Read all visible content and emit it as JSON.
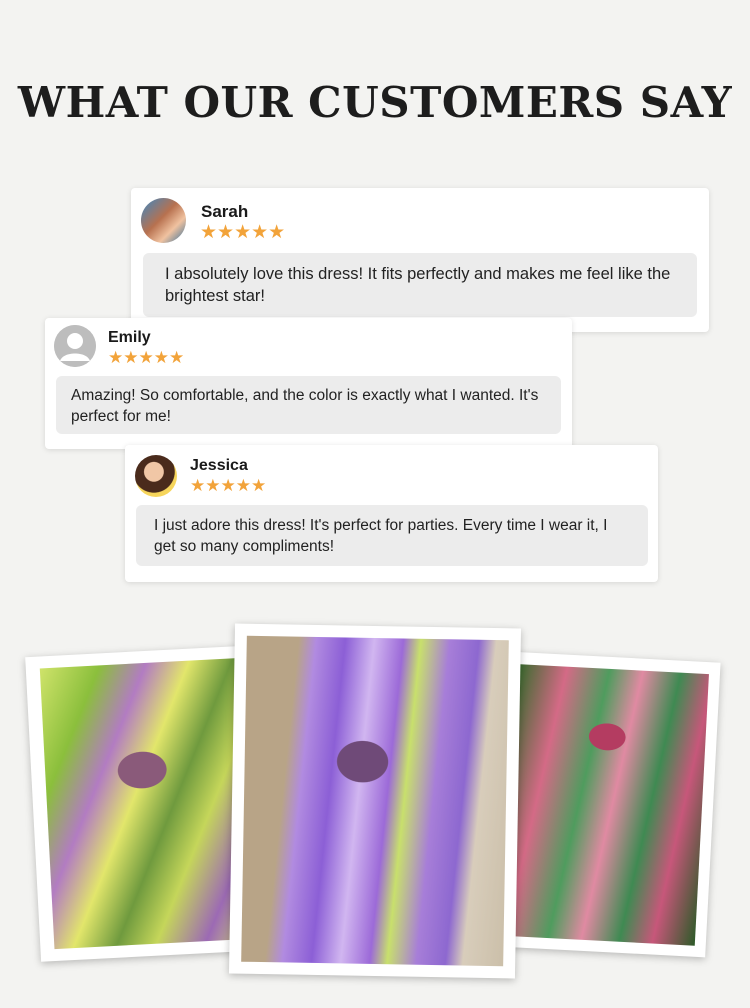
{
  "heading": "WHAT OUR CUSTOMERS SAY",
  "reviews": [
    {
      "name": "Sarah",
      "stars": "★★★★★",
      "rating": 5,
      "text": "I absolutely love this dress! It fits perfectly and makes me feel like the brightest star!"
    },
    {
      "name": "Emily",
      "stars": "★★★★★",
      "rating": 5,
      "text": "Amazing! So comfortable, and the color is exactly what I wanted. It's perfect for me!"
    },
    {
      "name": "Jessica",
      "stars": "★★★★★",
      "rating": 5,
      "text": "I just adore this dress! It's perfect for parties. Every time I wear it, I get so many compliments!"
    }
  ],
  "colors": {
    "background": "#f3f3f1",
    "star": "#f2a33a",
    "bubble": "#ececec",
    "heading": "#1d1d1d"
  }
}
